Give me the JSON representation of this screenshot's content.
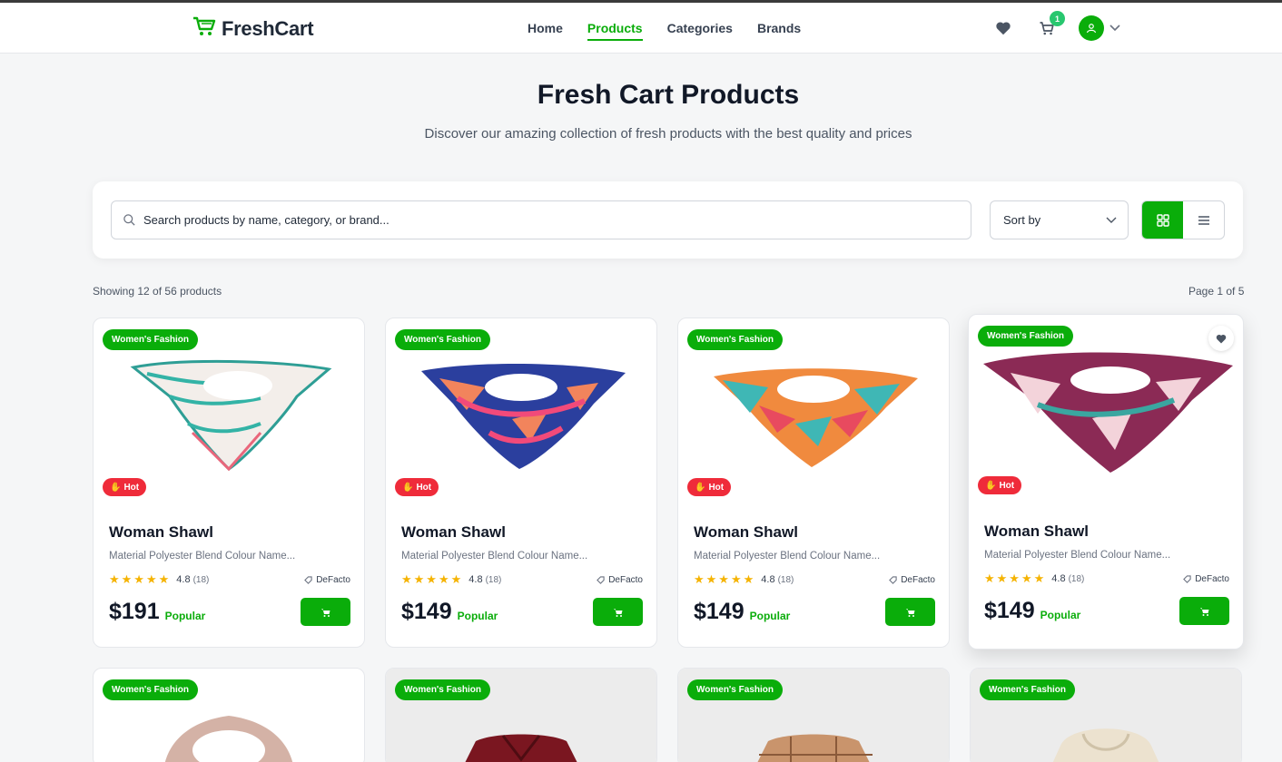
{
  "header": {
    "logo_text": "FreshCart",
    "nav": [
      {
        "label": "Home",
        "active": false
      },
      {
        "label": "Products",
        "active": true
      },
      {
        "label": "Categories",
        "active": false
      },
      {
        "label": "Brands",
        "active": false
      }
    ],
    "cart_count": "1",
    "icons": [
      "heart-icon",
      "cart-icon",
      "user-icon",
      "chevron-down-icon"
    ]
  },
  "hero": {
    "title": "Fresh Cart Products",
    "subtitle": "Discover our amazing collection of fresh products with the best quality and prices"
  },
  "filters": {
    "search_placeholder": "Search products by name, category, or brand...",
    "sort_label": "Sort by",
    "view_mode": "grid"
  },
  "results": {
    "showing": "Showing 12 of 56 products",
    "page": "Page 1 of 5"
  },
  "products": [
    {
      "category": "Women's Fashion",
      "badge": "Hot",
      "title": "Woman Shawl",
      "desc": "Material Polyester Blend Colour Name...",
      "rating": "4.8",
      "reviews": "(18)",
      "brand": "DeFacto",
      "price": "$191",
      "tag": "Popular"
    },
    {
      "category": "Women's Fashion",
      "badge": "Hot",
      "title": "Woman Shawl",
      "desc": "Material Polyester Blend Colour Name...",
      "rating": "4.8",
      "reviews": "(18)",
      "brand": "DeFacto",
      "price": "$149",
      "tag": "Popular"
    },
    {
      "category": "Women's Fashion",
      "badge": "Hot",
      "title": "Woman Shawl",
      "desc": "Material Polyester Blend Colour Name...",
      "rating": "4.8",
      "reviews": "(18)",
      "brand": "DeFacto",
      "price": "$149",
      "tag": "Popular"
    },
    {
      "category": "Women's Fashion",
      "badge": "Hot",
      "title": "Woman Shawl",
      "desc": "Material Polyester Blend Colour Name...",
      "rating": "4.8",
      "reviews": "(18)",
      "brand": "DeFacto",
      "price": "$149",
      "tag": "Popular"
    },
    {
      "category": "Women's Fashion"
    },
    {
      "category": "Women's Fashion"
    },
    {
      "category": "Women's Fashion"
    },
    {
      "category": "Women's Fashion"
    }
  ],
  "colors": {
    "accent": "#0aad0a",
    "hot": "#ef2b3a"
  }
}
